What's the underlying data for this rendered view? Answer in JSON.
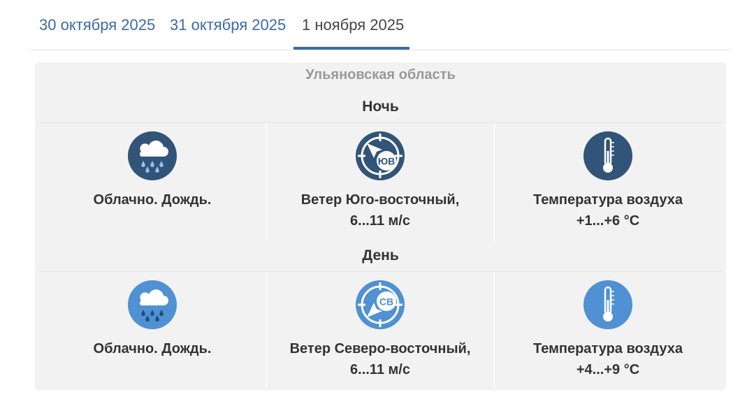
{
  "tabs": [
    {
      "label": "30 октября 2025"
    },
    {
      "label": "31 октября 2025"
    },
    {
      "label": "1 ноября 2025"
    }
  ],
  "region": "Ульяновская область",
  "periods": [
    {
      "title": "Ночь",
      "weather": {
        "label": "Облачно. Дождь.",
        "icon": "cloud-rain-icon"
      },
      "wind": {
        "line1": "Ветер Юго-восточный,",
        "line2": "6...11 м/с",
        "direction_abbr": "ЮВ",
        "icon": "wind-compass-icon"
      },
      "temp": {
        "line1": "Температура воздуха",
        "line2": "+1...+6 °С",
        "icon": "thermometer-icon"
      },
      "icon_color": "#315478"
    },
    {
      "title": "День",
      "weather": {
        "label": "Облачно. Дождь.",
        "icon": "cloud-rain-icon"
      },
      "wind": {
        "line1": "Ветер Северо-восточный,",
        "line2": "6...11 м/с",
        "direction_abbr": "СВ",
        "icon": "wind-compass-icon"
      },
      "temp": {
        "line1": "Температура воздуха",
        "line2": "+4...+9 °С",
        "icon": "thermometer-icon"
      },
      "icon_color": "#4f91d3"
    }
  ]
}
